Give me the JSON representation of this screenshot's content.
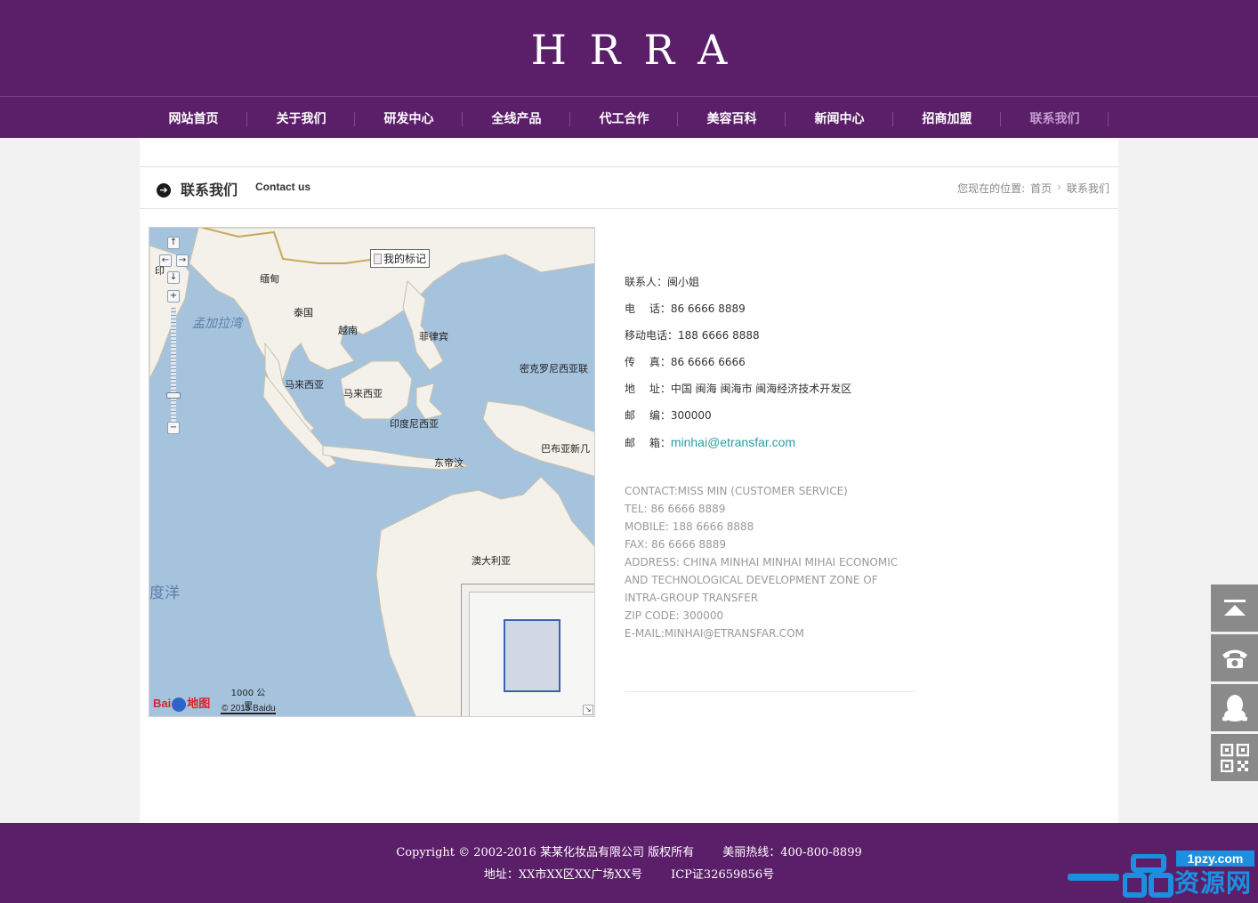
{
  "header": {
    "logo": "HRRA"
  },
  "nav": {
    "items": [
      {
        "label": "网站首页"
      },
      {
        "label": "关于我们"
      },
      {
        "label": "研发中心"
      },
      {
        "label": "全线产品"
      },
      {
        "label": "代工合作"
      },
      {
        "label": "美容百科"
      },
      {
        "label": "新闻中心"
      },
      {
        "label": "招商加盟"
      },
      {
        "label": "联系我们"
      }
    ],
    "active_index": 8
  },
  "page": {
    "title_cn": "联系我们",
    "title_en": "Contact us",
    "breadcrumb": {
      "prefix": "您现在的位置:",
      "home": "首页",
      "current": "联系我们"
    }
  },
  "map": {
    "marker_label": "我的标记",
    "labels": {
      "myanmar": "缅甸",
      "thailand": "泰国",
      "vietnam": "越南",
      "philippines": "菲律宾",
      "bay_of_bengal": "孟加拉湾",
      "malaysia_1": "马来西亚",
      "malaysia_2": "马来西亚",
      "indonesia": "印度尼西亚",
      "micronesia": "密克罗尼西亚联",
      "papua": "巴布亚新几",
      "east_timor": "东帝汶",
      "australia": "澳大利亚",
      "indian_ocean": "度洋",
      "india_partial": "印"
    },
    "scale": "1000 公里",
    "copyright": "© 2015 Baidu",
    "logo_left": "Bai",
    "logo_right": "地图"
  },
  "contact_cn": {
    "contact": "联系人：闽小姐",
    "phone": "电　 话：86 6666 8889",
    "mobile": "移动电话：188 6666 8888",
    "fax": "传　 真：86 6666 6666",
    "address": "地　 址：中国 闽海 闽海市 闽海经济技术开发区",
    "zip": "邮　 编：300000",
    "email_label": "邮　 箱：",
    "email": "minhai@etransfar.com"
  },
  "contact_en": {
    "line1": "CONTACT:MISS MIN (CUSTOMER SERVICE)",
    "line2": "TEL: 86 6666 8889",
    "line3": "MOBILE: 188 6666 8888",
    "line4": "FAX: 86 6666 8889",
    "line5": "ADDRESS: CHINA MINHAI MINHAI MIHAI ECONOMIC",
    "line6": "AND TECHNOLOGICAL DEVELOPMENT ZONE OF",
    "line7": "INTRA-GROUP TRANSFER",
    "line8": "ZIP CODE: 300000",
    "line9": "E-MAIL:MINHAI@ETRANSFAR.COM"
  },
  "side_tools": {
    "icons": [
      "back-to-top-icon",
      "phone-icon",
      "qq-icon",
      "qrcode-icon"
    ],
    "color": "#8a8a8a"
  },
  "footer": {
    "copyright": "Copyright © 2002-2016 某某化妆品有限公司 版权所有",
    "hotline": "美丽热线：400-800-8899",
    "address": "地址：XX市XX区XX广场XX号",
    "icp": "ICP证32659856号"
  },
  "watermark": {
    "url": "1pzy.com",
    "text": "资源网"
  },
  "colors": {
    "brand": "#5b1f69",
    "nav_active": "#c59ad0",
    "email": "#2a9ea5",
    "watermark": "#1c8fe0"
  }
}
